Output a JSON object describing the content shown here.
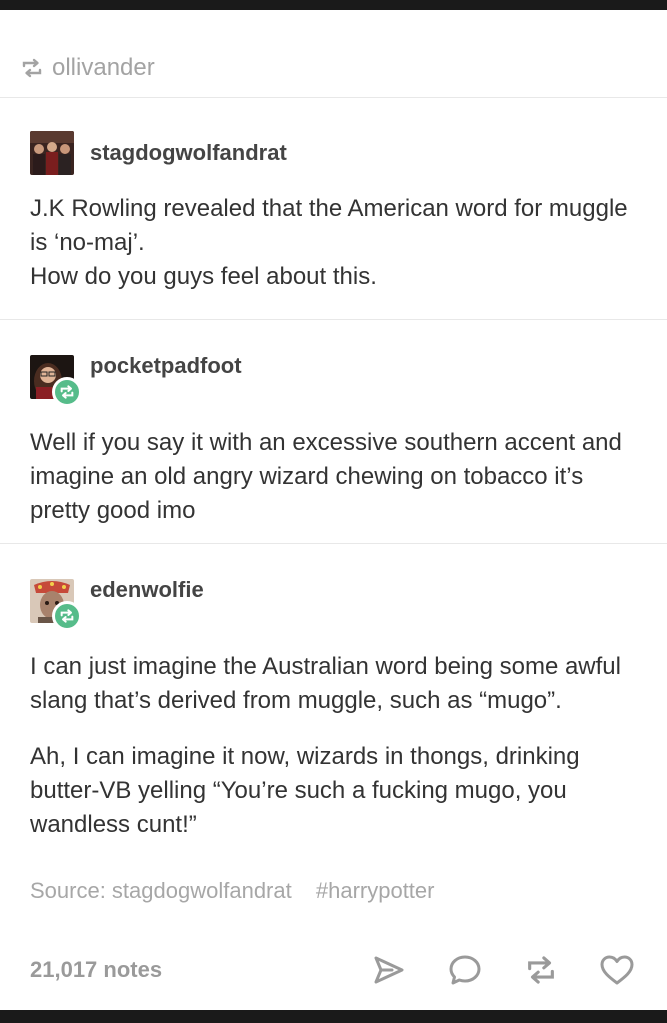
{
  "reblog_header": {
    "icon": "reblog-icon",
    "username": "ollivander"
  },
  "posts": [
    {
      "username": "stagdogwolfandrat",
      "avatar": "group-photo-avatar",
      "reblogged": false,
      "paragraphs": [
        "J.K Rowling revealed that the American word for muggle is ‘no-maj’.",
        "How do you guys feel about this."
      ]
    },
    {
      "username": "pocketpadfoot",
      "avatar": "woman-glasses-avatar",
      "reblogged": true,
      "paragraphs": [
        "Well if you say it with an excessive southern accent and imagine an old angry wizard chewing on tobacco it’s pretty good imo"
      ]
    },
    {
      "username": "edenwolfie",
      "avatar": "costume-character-avatar",
      "reblogged": true,
      "paragraphs": [
        "I can just imagine the Australian word being some awful slang that’s derived from muggle, such as “mugo”.",
        "Ah, I can imagine it now, wizards in thongs, drinking butter-VB yelling “You’re such a fucking mugo, you wandless cunt!”"
      ]
    }
  ],
  "source": {
    "label": "Source: stagdogwolfandrat",
    "tag": "#harrypotter"
  },
  "footer": {
    "notes": "21,017 notes",
    "actions": [
      "share-icon",
      "reply-icon",
      "reblog-icon",
      "like-icon"
    ]
  },
  "colors": {
    "badge": "#56bc8a",
    "muted": "#a7a7a7",
    "text": "#333333"
  }
}
